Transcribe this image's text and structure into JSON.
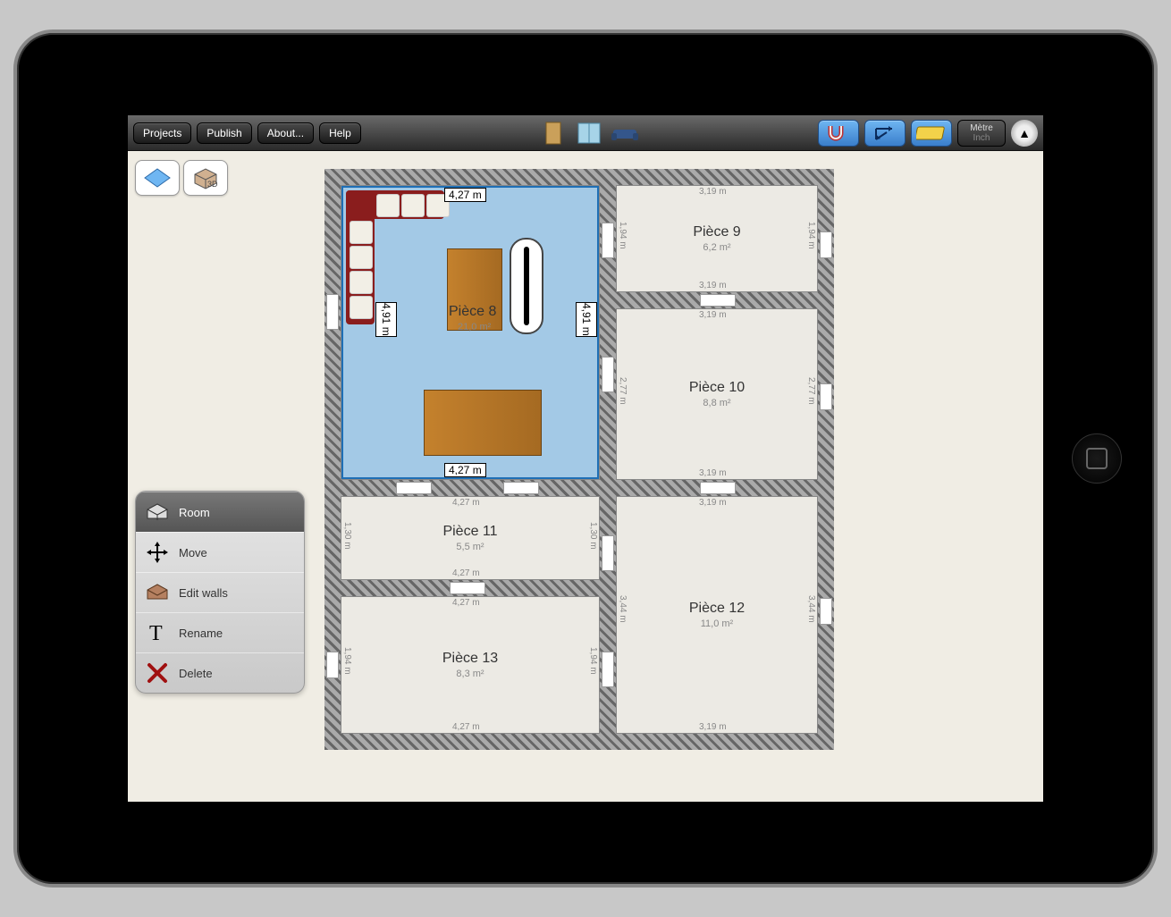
{
  "toolbar": {
    "projects": "Projects",
    "publish": "Publish",
    "about": "About...",
    "help": "Help",
    "unit_metric": "Mètre",
    "unit_imperial": "Inch"
  },
  "context_menu": {
    "room": "Room",
    "move": "Move",
    "edit_walls": "Edit walls",
    "rename": "Rename",
    "delete": "Delete"
  },
  "rooms": {
    "r8": {
      "name": "Pièce 8",
      "area": "21,0 m²",
      "w_top": "4,27 m",
      "w_bottom": "4,27 m",
      "h_left": "4,91 m",
      "h_right": "4,91 m"
    },
    "r9": {
      "name": "Pièce 9",
      "area": "6,2 m²",
      "w_top": "3,19 m",
      "w_bottom": "3,19 m",
      "h_left": "1,94 m",
      "h_right": "1,94 m"
    },
    "r10": {
      "name": "Pièce 10",
      "area": "8,8 m²",
      "w_top": "3,19 m",
      "w_bottom": "3,19 m",
      "h_left": "2,77 m",
      "h_right": "2,77 m"
    },
    "r11": {
      "name": "Pièce 11",
      "area": "5,5 m²",
      "w_top": "4,27 m",
      "w_bottom": "4,27 m",
      "h_left": "1,30 m",
      "h_right": "1,30 m"
    },
    "r12": {
      "name": "Pièce 12",
      "area": "11,0 m²",
      "w_top": "3,19 m",
      "w_bottom": "3,19 m",
      "h_left": "3,44 m",
      "h_right": "3,44 m"
    },
    "r13": {
      "name": "Pièce 13",
      "area": "8,3 m²",
      "w_top": "4,27 m",
      "w_bottom": "4,27 m",
      "h_left": "1,94 m",
      "h_right": "1,94 m"
    }
  }
}
